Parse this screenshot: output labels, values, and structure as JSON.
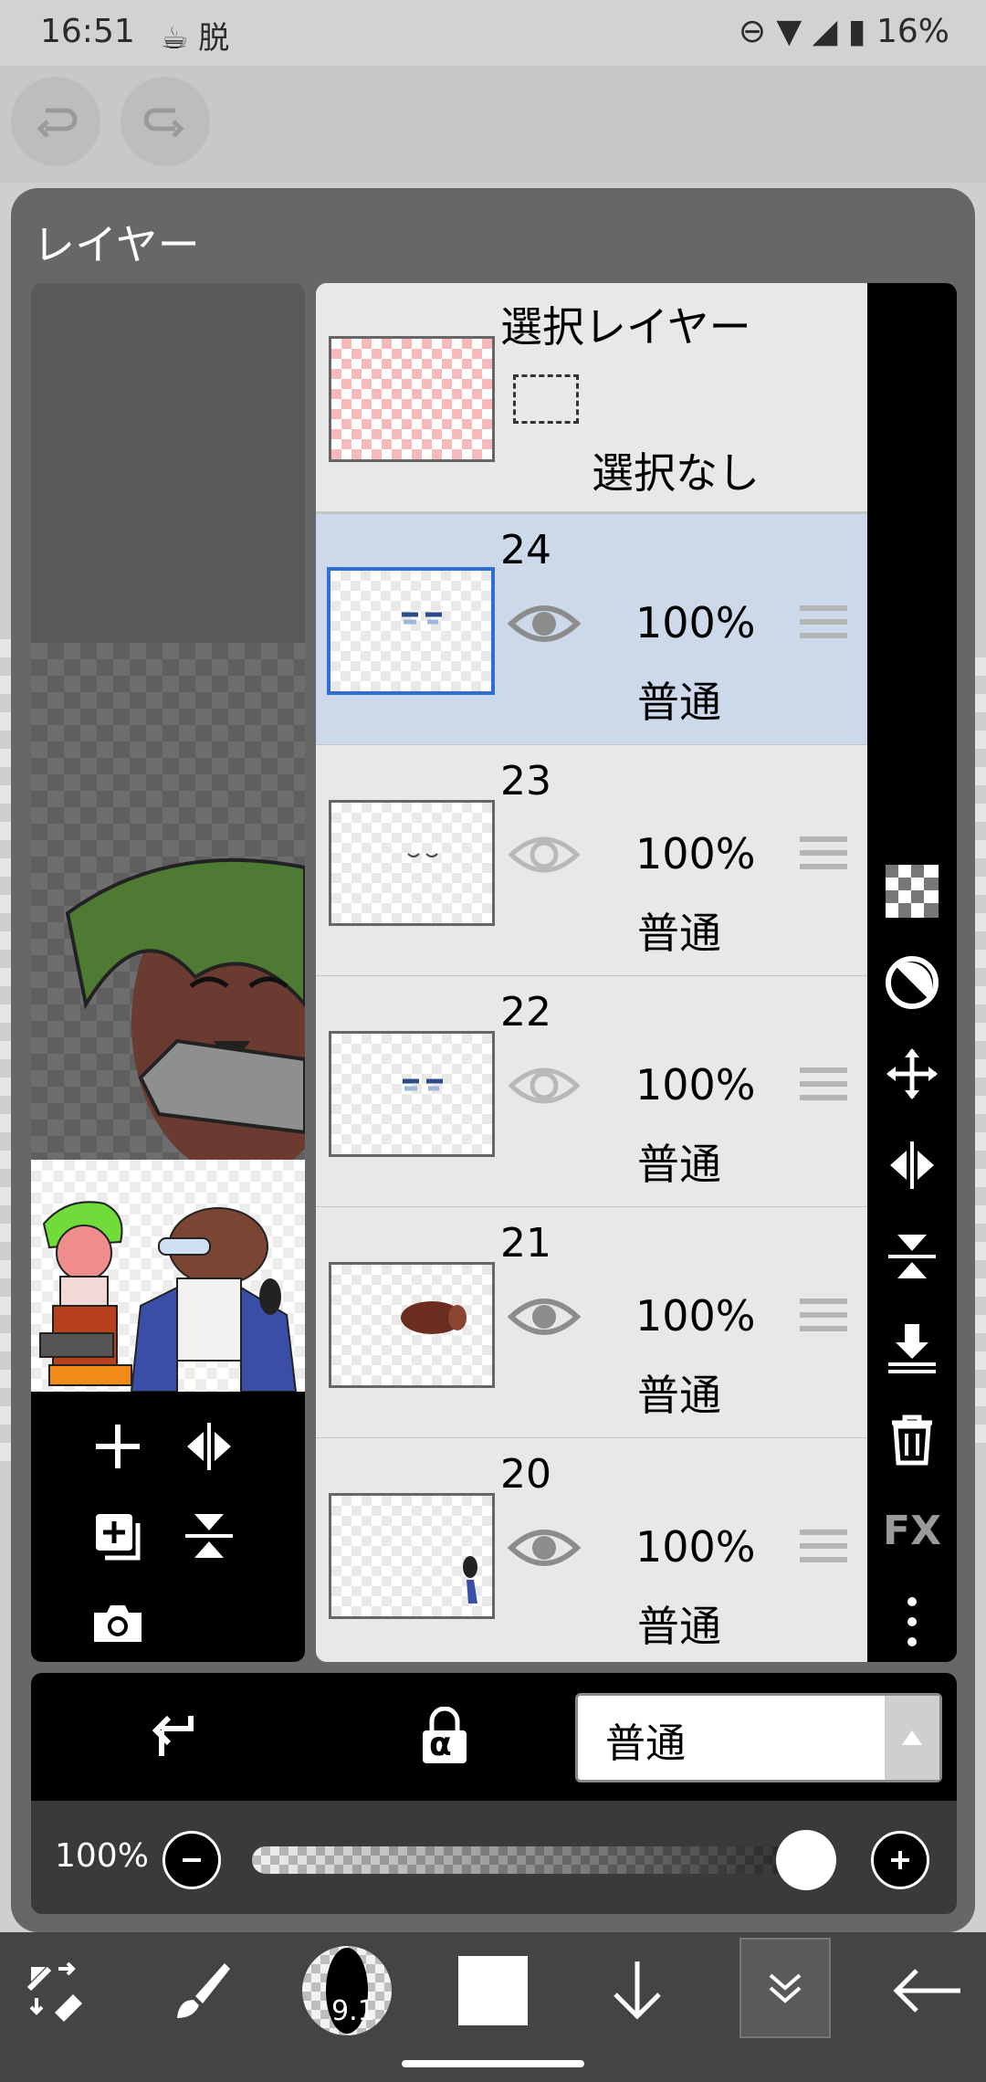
{
  "status_bar": {
    "time": "16:51",
    "app_icons": "☕ 脱",
    "right_text": "⊖ ▼ ◢ ▮ 16%"
  },
  "panel": {
    "title": "レイヤー"
  },
  "selection_layer": {
    "title": "選択レイヤー",
    "state": "選択なし"
  },
  "layers": [
    {
      "number": "24",
      "opacity": "100%",
      "mode": "普通",
      "visible": true,
      "selected": true
    },
    {
      "number": "23",
      "opacity": "100%",
      "mode": "普通",
      "visible": false,
      "selected": false
    },
    {
      "number": "22",
      "opacity": "100%",
      "mode": "普通",
      "visible": false,
      "selected": false
    },
    {
      "number": "21",
      "opacity": "100%",
      "mode": "普通",
      "visible": true,
      "selected": false
    },
    {
      "number": "20",
      "opacity": "100%",
      "mode": "普通",
      "visible": true,
      "selected": false
    }
  ],
  "right_toolbar": {
    "fx_label": "FX",
    "icons": [
      "transparency-checker-icon",
      "clip-circle-icon",
      "move-icon",
      "flip-horizontal-icon",
      "flip-vertical-icon",
      "merge-down-icon",
      "trash-icon",
      "fx-icon",
      "more-vertical-icon"
    ]
  },
  "thumb_tools": {
    "icons": [
      "add-layer-icon",
      "flip-horizontal-icon",
      "duplicate-layer-icon",
      "flip-vertical-icon",
      "camera-icon"
    ]
  },
  "mode_bar": {
    "blend_mode": "普通",
    "alpha_lock_label": "α"
  },
  "opacity": {
    "label": "100%",
    "value": 1.0
  },
  "bottom_toolbar": {
    "brush_size": "9.1",
    "icons": [
      "transform-tools-icon",
      "brush-icon",
      "brush-size-icon",
      "color-swatch-icon",
      "arrow-down-icon",
      "collapse-icon",
      "back-arrow-icon"
    ]
  },
  "colors": {
    "selected_row": "#ccd9ea",
    "selected_border": "#2e6fd1",
    "panel": "#676767"
  }
}
